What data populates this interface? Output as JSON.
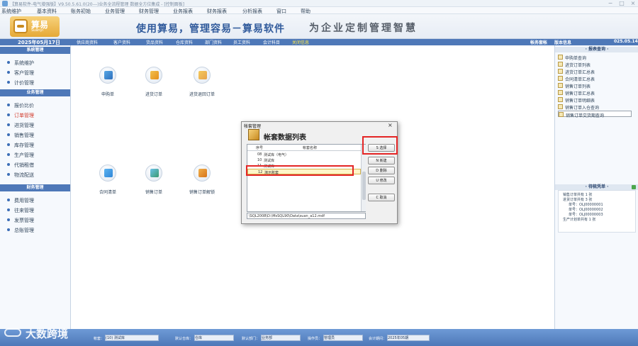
{
  "titlebar": {
    "title": "【算易软件-电气增强版】V9.50.5.61.0(20---)业务全流程管理 数据全方位集成 - [控制面板]"
  },
  "menu": [
    "系统维护",
    "基本资料",
    "账务初始",
    "业务管理",
    "财务管理",
    "业务报表",
    "财务报表",
    "分析报表",
    "窗口",
    "帮助"
  ],
  "banner": {
    "logo_text": "算易",
    "logo_sub": "Suanyi",
    "slogan": "使用算易，管理容易－算易软件",
    "slogan2": "为企业定制管理智慧"
  },
  "navbar": {
    "date": "2025年05月17日",
    "links": [
      "供应商资料",
      "客户资料",
      "货品资料",
      "仓库资料",
      "部门资料",
      "员工资料",
      "会计科目",
      "关闭信息"
    ],
    "right_items": [
      "帐务套帐",
      "版本信息"
    ],
    "version_code": "025.05.14"
  },
  "sidebar": {
    "sections": [
      {
        "title": "系统管理",
        "items": [
          "系统维护",
          "客户管理",
          "计价管理"
        ]
      },
      {
        "title": "业务管理",
        "items": [
          "报价比价",
          "订单管理",
          "进货管理",
          "销售管理",
          "库存管理",
          "生产管理",
          "代销租借",
          "物流配送"
        ]
      },
      {
        "title": "财务管理",
        "items": [
          "费用管理",
          "往来管理",
          "发票管理",
          "总账管理"
        ]
      }
    ]
  },
  "modules": [
    "申购单",
    "进货订单",
    "进货退回订单",
    "合同清单",
    "销售订单",
    "销售订单解锁"
  ],
  "report_panel": {
    "header": "· 报表查询 ·",
    "items": [
      "申购单查询",
      "进货订单列表",
      "进货订单汇总表",
      "合同清单汇总表",
      "销售订单列表",
      "销售订单汇总表",
      "销售订单明细表",
      "销售订单入仓查询",
      "销售订单交货期查询"
    ]
  },
  "tree_panel": {
    "header": "· 待梳凭单 ·",
    "lines": [
      "销售订单共有 1 张",
      "进货订单共有 3 张",
      "单号：OLJ00000001",
      "单号：OLJ00000002",
      "单号：OLJ00000003",
      "生产计划单共有 1 张"
    ]
  },
  "dialog": {
    "title": "帐套管理",
    "heading": "帐套数据列表",
    "columns": [
      "序号",
      "帐套名称"
    ],
    "rows": [
      {
        "no": "08",
        "name": "测试库（电气）"
      },
      {
        "no": "10",
        "name": "测试库"
      },
      {
        "no": "11",
        "name": "测试库"
      },
      {
        "no": "12",
        "name": "演示账套"
      }
    ],
    "selected_index": 3,
    "path": "\\SQL2008\\D:\\MsSQL90\\Data\\suan_a12.mdf",
    "buttons": [
      "S 选择",
      "N 新建",
      "D 删除",
      "U 修改",
      "C 取消"
    ]
  },
  "statusbar": {
    "fields": [
      {
        "label": "帐套：",
        "value": "(10) 测试库"
      },
      {
        "label": "默认仓库：",
        "value": "仓库"
      },
      {
        "label": "默认部门：",
        "value": "业务部"
      },
      {
        "label": "操作员：",
        "value": "管理员"
      },
      {
        "label": "会计期间：",
        "value": "2025年05期"
      }
    ]
  },
  "watermark": "大数跨境"
}
